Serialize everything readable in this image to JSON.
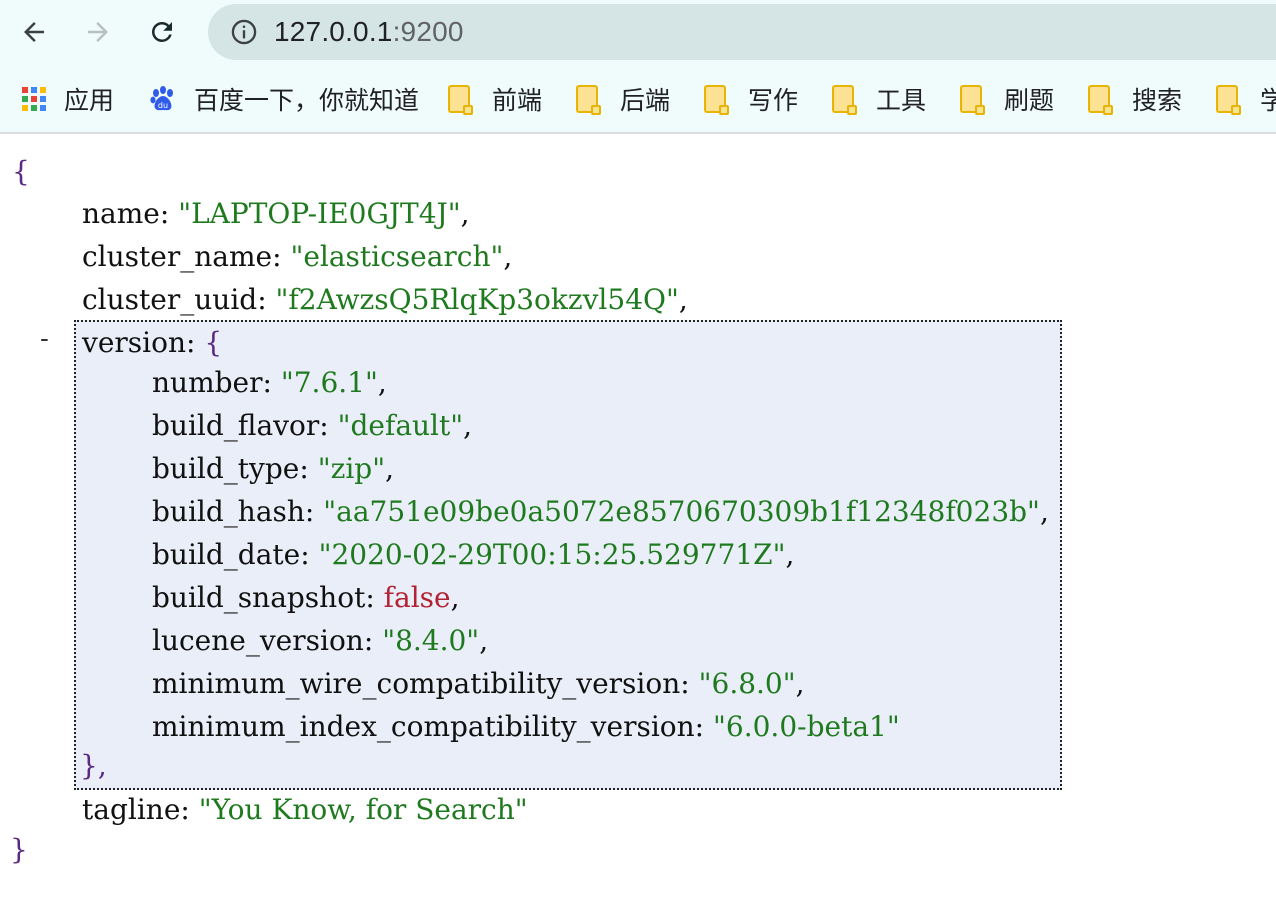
{
  "browser": {
    "url_host": "127.0.0.1",
    "url_port": ":9200"
  },
  "bookmarks": [
    {
      "label": "应用"
    },
    {
      "label": "百度一下，你就知道"
    },
    {
      "label": "前端"
    },
    {
      "label": "后端"
    },
    {
      "label": "写作"
    },
    {
      "label": "工具"
    },
    {
      "label": "刷题"
    },
    {
      "label": "搜索"
    },
    {
      "label": "学"
    }
  ],
  "json": {
    "open_brace": "{",
    "close_brace": "}",
    "collapse_toggle": "-",
    "fields": {
      "name": {
        "key": "name",
        "value": "\"LAPTOP-IE0GJT4J\""
      },
      "cluster_name": {
        "key": "cluster_name",
        "value": "\"elasticsearch\""
      },
      "cluster_uuid": {
        "key": "cluster_uuid",
        "value": "\"f2AwzsQ5RlqKp3okzvl54Q\""
      },
      "version": {
        "key": "version"
      },
      "tagline": {
        "key": "tagline",
        "value": "\"You Know, for Search\""
      }
    },
    "version": [
      {
        "key": "number",
        "value": "\"7.6.1\"",
        "type": "str",
        "comma": ","
      },
      {
        "key": "build_flavor",
        "value": "\"default\"",
        "type": "str",
        "comma": ","
      },
      {
        "key": "build_type",
        "value": "\"zip\"",
        "type": "str",
        "comma": ","
      },
      {
        "key": "build_hash",
        "value": "\"aa751e09be0a5072e8570670309b1f12348f023b\"",
        "type": "str",
        "comma": ","
      },
      {
        "key": "build_date",
        "value": "\"2020-02-29T00:15:25.529771Z\"",
        "type": "str",
        "comma": ","
      },
      {
        "key": "build_snapshot",
        "value": "false",
        "type": "bool",
        "comma": ","
      },
      {
        "key": "lucene_version",
        "value": "\"8.4.0\"",
        "type": "str",
        "comma": ","
      },
      {
        "key": "minimum_wire_compatibility_version",
        "value": "\"6.8.0\"",
        "type": "str",
        "comma": ","
      },
      {
        "key": "minimum_index_compatibility_version",
        "value": "\"6.0.0-beta1\"",
        "type": "str",
        "comma": ""
      }
    ],
    "version_close": "},"
  },
  "colors": {
    "string": "#1f7a1f",
    "boolean": "#b22234",
    "brace": "#5a2a82",
    "highlight": "#eaeef8"
  }
}
